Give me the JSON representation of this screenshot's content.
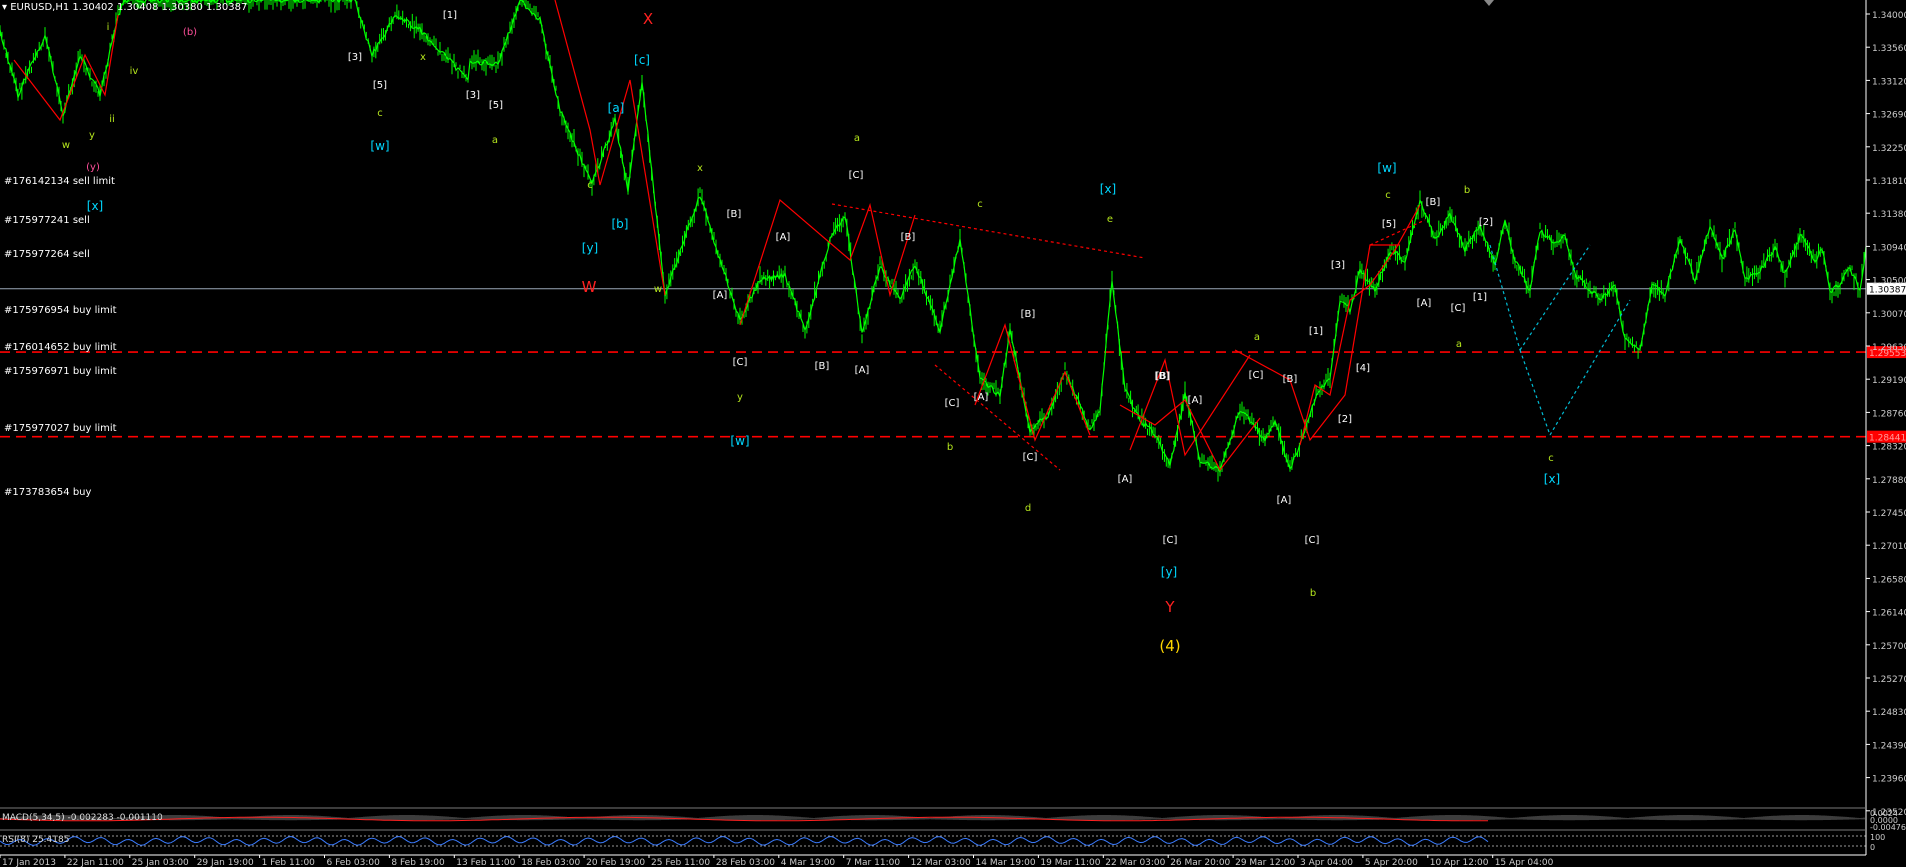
{
  "header": {
    "symbol_timeframe": "EURUSD,H1",
    "ohlc": "1.30402 1.30408 1.30380 1.30387"
  },
  "colors": {
    "background": "#000000",
    "candles": "#00ff00",
    "wave_lines": "#ff0000",
    "order_lines": "#ff0000",
    "bid_line": "#9aa8b8",
    "projection": "#00bcd4",
    "price_label": "#cccccc",
    "highlight_price_box": "#ff0000",
    "bid_box": "#ffffff",
    "axis": "#ffffff"
  },
  "price_axis": {
    "labels": [
      "1.34000",
      "1.33560",
      "1.33120",
      "1.32690",
      "1.32250",
      "1.31810",
      "1.31380",
      "1.30940",
      "1.30500",
      "1.30070",
      "1.29630",
      "1.29190",
      "1.28760",
      "1.28320",
      "1.27880",
      "1.27450",
      "1.27010",
      "1.26580",
      "1.26140",
      "1.25700",
      "1.25270",
      "1.24830",
      "1.24390",
      "1.23960",
      "1.23520"
    ],
    "current_bid": "1.30387",
    "order_price_boxes": [
      "1.29553",
      "1.28441"
    ]
  },
  "time_axis": {
    "labels": [
      "17 Jan 2013",
      "22 Jan 11:00",
      "25 Jan 03:00",
      "29 Jan 19:00",
      "1 Feb 11:00",
      "6 Feb 03:00",
      "8 Feb 19:00",
      "13 Feb 11:00",
      "18 Feb 03:00",
      "20 Feb 19:00",
      "25 Feb 11:00",
      "28 Feb 03:00",
      "4 Mar 19:00",
      "7 Mar 11:00",
      "12 Mar 03:00",
      "14 Mar 19:00",
      "19 Mar 11:00",
      "22 Mar 03:00",
      "26 Mar 20:00",
      "29 Mar 12:00",
      "3 Apr 04:00",
      "5 Apr 20:00",
      "10 Apr 12:00",
      "15 Apr 04:00"
    ]
  },
  "orders": [
    {
      "label": "#176142134 sell limit"
    },
    {
      "label": "#175977241 sell"
    },
    {
      "label": "#175977264 sell"
    },
    {
      "label": "#175976954 buy limit"
    },
    {
      "label": "#176014652 buy limit"
    },
    {
      "label": "#175976971 buy limit"
    },
    {
      "label": "#175977027 buy limit"
    },
    {
      "label": "#173783654 buy"
    }
  ],
  "indicators": {
    "macd": "MACD(5,34,5) -0.002283 -0.001110",
    "rsi": "RSI(8) 25.4185",
    "macd_scale": [
      "0.0024",
      "0.0000",
      "-0.00476"
    ],
    "rsi_scale": [
      "100",
      "0"
    ]
  },
  "wave_labels": [
    {
      "t": "(b)",
      "c": "#ff4f9a"
    },
    {
      "t": "(y)",
      "c": "#ff4f9a"
    },
    {
      "t": "i",
      "c": "#b5e61d"
    },
    {
      "t": "ii",
      "c": "#b5e61d"
    },
    {
      "t": "iv",
      "c": "#b5e61d"
    },
    {
      "t": "w",
      "c": "#b5e61d"
    },
    {
      "t": "y",
      "c": "#b5e61d"
    },
    {
      "t": "[x]",
      "c": "#00d8ff"
    },
    {
      "t": "[3]",
      "c": "#ffffff"
    },
    {
      "t": "[5]",
      "c": "#ffffff"
    },
    {
      "t": "c",
      "c": "#b5e61d"
    },
    {
      "t": "[w]",
      "c": "#00d8ff"
    },
    {
      "t": "x",
      "c": "#b5e61d"
    },
    {
      "t": "[1]",
      "c": "#ffffff"
    },
    {
      "t": "[3]",
      "c": "#ffffff"
    },
    {
      "t": "[5]",
      "c": "#ffffff"
    },
    {
      "t": "a",
      "c": "#b5e61d"
    },
    {
      "t": "X",
      "c": "#ff2020"
    },
    {
      "t": "[c]",
      "c": "#00d8ff"
    },
    {
      "t": "[a]",
      "c": "#00d8ff"
    },
    {
      "t": "[b]",
      "c": "#00d8ff"
    },
    {
      "t": "c",
      "c": "#b5e61d"
    },
    {
      "t": "[y]",
      "c": "#00d8ff"
    },
    {
      "t": "W",
      "c": "#ff2020"
    },
    {
      "t": "w",
      "c": "#b5e61d"
    },
    {
      "t": "x",
      "c": "#b5e61d"
    },
    {
      "t": "[B]",
      "c": "#ffffff"
    },
    {
      "t": "[A]",
      "c": "#ffffff"
    },
    {
      "t": "[A]",
      "c": "#ffffff"
    },
    {
      "t": "[C]",
      "c": "#ffffff"
    },
    {
      "t": "y",
      "c": "#b5e61d"
    },
    {
      "t": "[w]",
      "c": "#00d8ff"
    },
    {
      "t": "a",
      "c": "#b5e61d"
    },
    {
      "t": "[C]",
      "c": "#ffffff"
    },
    {
      "t": "[B]",
      "c": "#ffffff"
    },
    {
      "t": "[B]",
      "c": "#ffffff"
    },
    {
      "t": "[A]",
      "c": "#ffffff"
    },
    {
      "t": "c",
      "c": "#b5e61d"
    },
    {
      "t": "[B]",
      "c": "#ffffff"
    },
    {
      "t": "[A]",
      "c": "#ffffff"
    },
    {
      "t": "[C]",
      "c": "#ffffff"
    },
    {
      "t": "b",
      "c": "#b5e61d"
    },
    {
      "t": "[C]",
      "c": "#ffffff"
    },
    {
      "t": "d",
      "c": "#b5e61d"
    },
    {
      "t": "[x]",
      "c": "#00d8ff"
    },
    {
      "t": "e",
      "c": "#b5e61d"
    },
    {
      "t": "[B]",
      "c": "#ffffff"
    },
    {
      "t": "[A]",
      "c": "#ffffff"
    },
    {
      "t": "[A]",
      "c": "#ffffff"
    },
    {
      "t": "[C]",
      "c": "#ffffff"
    },
    {
      "t": "[y]",
      "c": "#00d8ff"
    },
    {
      "t": "Y",
      "c": "#ff2020"
    },
    {
      "t": "(4)",
      "c": "#ffd700"
    },
    {
      "t": "[B]",
      "c": "#ffffff"
    },
    {
      "t": "[C]",
      "c": "#ffffff"
    },
    {
      "t": "[B]",
      "c": "#ffffff"
    },
    {
      "t": "[A]",
      "c": "#ffffff"
    },
    {
      "t": "[C]",
      "c": "#ffffff"
    },
    {
      "t": "a",
      "c": "#b5e61d"
    },
    {
      "t": "b",
      "c": "#b5e61d"
    },
    {
      "t": "[1]",
      "c": "#ffffff"
    },
    {
      "t": "[2]",
      "c": "#ffffff"
    },
    {
      "t": "[3]",
      "c": "#ffffff"
    },
    {
      "t": "[4]",
      "c": "#ffffff"
    },
    {
      "t": "[5]",
      "c": "#ffffff"
    },
    {
      "t": "[w]",
      "c": "#00d8ff"
    },
    {
      "t": "c",
      "c": "#b5e61d"
    },
    {
      "t": "[B]",
      "c": "#ffffff"
    },
    {
      "t": "b",
      "c": "#b5e61d"
    },
    {
      "t": "[2]",
      "c": "#ffffff"
    },
    {
      "t": "[A]",
      "c": "#ffffff"
    },
    {
      "t": "[C]",
      "c": "#ffffff"
    },
    {
      "t": "[1]",
      "c": "#ffffff"
    },
    {
      "t": "a",
      "c": "#b5e61d"
    },
    {
      "t": "c",
      "c": "#b5e61d"
    },
    {
      "t": "[x]",
      "c": "#00d8ff"
    }
  ]
}
